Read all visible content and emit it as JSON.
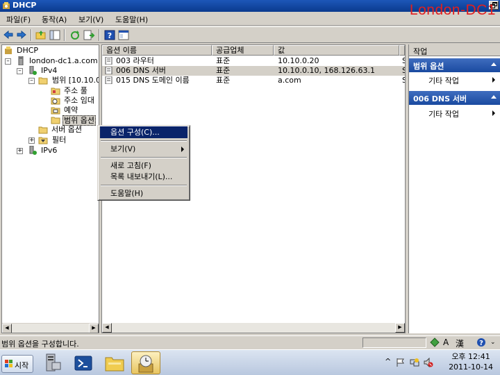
{
  "window": {
    "title": "DHCP"
  },
  "watermark": "London-DC1",
  "menu": [
    "파일(F)",
    "동작(A)",
    "보기(V)",
    "도움말(H)"
  ],
  "tree": {
    "root": "DHCP",
    "server": "london-dc1.a.com",
    "ipv4": "IPv4",
    "scope": "범위 [10.10.0",
    "address_pool": "주소 풀",
    "address_lease": "주소 임대",
    "reservations": "예약",
    "scope_options": "범위 옵션",
    "server_options": "서버 옵션",
    "filters": "필터",
    "ipv6": "IPv6"
  },
  "list": {
    "columns": [
      "옵션 이름",
      "공급업체",
      "값"
    ],
    "rows": [
      {
        "name": "003 라우터",
        "vendor": "표준",
        "value": "10.10.0.20"
      },
      {
        "name": "006 DNS 서버",
        "vendor": "표준",
        "value": "10.10.0.10, 168.126.63.1"
      },
      {
        "name": "015 DNS 도메인 이름",
        "vendor": "표준",
        "value": "a.com"
      }
    ],
    "overflow_marker": "S"
  },
  "actions": {
    "header": "작업",
    "sections": [
      {
        "title": "범위 옵션",
        "item": "기타 작업"
      },
      {
        "title": "006 DNS 서버",
        "item": "기타 작업"
      }
    ]
  },
  "context_menu": {
    "configure": "옵션 구성(C)...",
    "view": "보기(V)",
    "refresh": "새로 고침(F)",
    "export": "목록 내보내기(L)...",
    "help": "도움말(H)"
  },
  "status": {
    "text": "범위 옵션을 구성합니다."
  },
  "ime": {
    "mode": "A",
    "hanja": "漢"
  },
  "taskbar": {
    "start": "시작",
    "time": "오후 12:41",
    "date": "2011-10-14"
  },
  "colors": {
    "title_bar": "#1d57b8",
    "selection": "#0a246a",
    "action_header": "#3f6dbf",
    "watermark": "#e02020"
  }
}
